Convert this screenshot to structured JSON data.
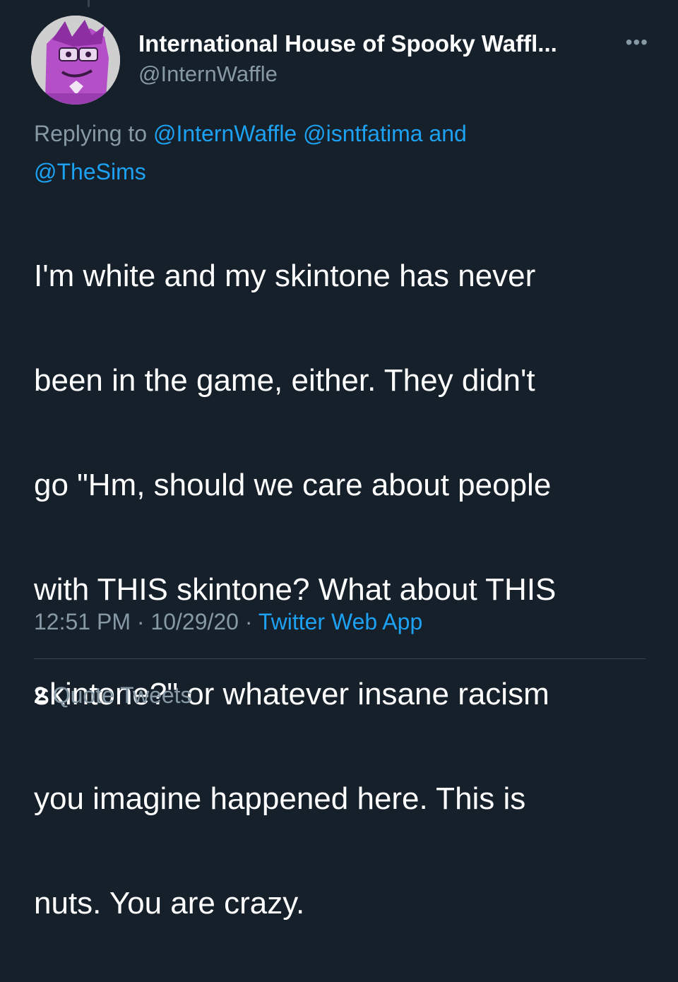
{
  "account": {
    "display_name": "International House of Spooky Waffl...",
    "handle": "@InternWaffle"
  },
  "reply": {
    "prefix": "Replying to",
    "mentions": [
      "@InternWaffle",
      "@isntfatima",
      "@TheSims"
    ],
    "joiner": "and"
  },
  "tweet": {
    "lines": [
      "I'm white and my skintone has never",
      "been in the game, either. They didn't",
      "go \"Hm, should we care about people",
      "with THIS skintone? What about THIS",
      "skintone?\" or whatever insane racism",
      "you imagine happened here. This is",
      "nuts. You are crazy."
    ]
  },
  "meta": {
    "time": "12:51 PM",
    "date": "10/29/20",
    "source": "Twitter Web App",
    "separator": "·"
  },
  "stats": {
    "quote_count": "2",
    "quote_label": "Quote Tweets"
  },
  "icons": {
    "more": "more-icon"
  },
  "colors": {
    "background": "#15202b",
    "primary_text": "#ffffff",
    "secondary_text": "#8899a6",
    "accent": "#1da1f2",
    "divider": "#38444d"
  }
}
